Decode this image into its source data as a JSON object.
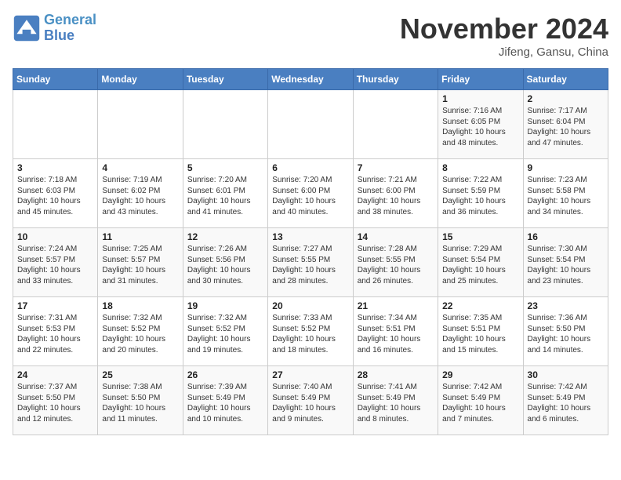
{
  "header": {
    "logo_line1": "General",
    "logo_line2": "Blue",
    "month": "November 2024",
    "location": "Jifeng, Gansu, China"
  },
  "weekdays": [
    "Sunday",
    "Monday",
    "Tuesday",
    "Wednesday",
    "Thursday",
    "Friday",
    "Saturday"
  ],
  "weeks": [
    [
      {
        "day": "",
        "info": ""
      },
      {
        "day": "",
        "info": ""
      },
      {
        "day": "",
        "info": ""
      },
      {
        "day": "",
        "info": ""
      },
      {
        "day": "",
        "info": ""
      },
      {
        "day": "1",
        "info": "Sunrise: 7:16 AM\nSunset: 6:05 PM\nDaylight: 10 hours and 48 minutes."
      },
      {
        "day": "2",
        "info": "Sunrise: 7:17 AM\nSunset: 6:04 PM\nDaylight: 10 hours and 47 minutes."
      }
    ],
    [
      {
        "day": "3",
        "info": "Sunrise: 7:18 AM\nSunset: 6:03 PM\nDaylight: 10 hours and 45 minutes."
      },
      {
        "day": "4",
        "info": "Sunrise: 7:19 AM\nSunset: 6:02 PM\nDaylight: 10 hours and 43 minutes."
      },
      {
        "day": "5",
        "info": "Sunrise: 7:20 AM\nSunset: 6:01 PM\nDaylight: 10 hours and 41 minutes."
      },
      {
        "day": "6",
        "info": "Sunrise: 7:20 AM\nSunset: 6:00 PM\nDaylight: 10 hours and 40 minutes."
      },
      {
        "day": "7",
        "info": "Sunrise: 7:21 AM\nSunset: 6:00 PM\nDaylight: 10 hours and 38 minutes."
      },
      {
        "day": "8",
        "info": "Sunrise: 7:22 AM\nSunset: 5:59 PM\nDaylight: 10 hours and 36 minutes."
      },
      {
        "day": "9",
        "info": "Sunrise: 7:23 AM\nSunset: 5:58 PM\nDaylight: 10 hours and 34 minutes."
      }
    ],
    [
      {
        "day": "10",
        "info": "Sunrise: 7:24 AM\nSunset: 5:57 PM\nDaylight: 10 hours and 33 minutes."
      },
      {
        "day": "11",
        "info": "Sunrise: 7:25 AM\nSunset: 5:57 PM\nDaylight: 10 hours and 31 minutes."
      },
      {
        "day": "12",
        "info": "Sunrise: 7:26 AM\nSunset: 5:56 PM\nDaylight: 10 hours and 30 minutes."
      },
      {
        "day": "13",
        "info": "Sunrise: 7:27 AM\nSunset: 5:55 PM\nDaylight: 10 hours and 28 minutes."
      },
      {
        "day": "14",
        "info": "Sunrise: 7:28 AM\nSunset: 5:55 PM\nDaylight: 10 hours and 26 minutes."
      },
      {
        "day": "15",
        "info": "Sunrise: 7:29 AM\nSunset: 5:54 PM\nDaylight: 10 hours and 25 minutes."
      },
      {
        "day": "16",
        "info": "Sunrise: 7:30 AM\nSunset: 5:54 PM\nDaylight: 10 hours and 23 minutes."
      }
    ],
    [
      {
        "day": "17",
        "info": "Sunrise: 7:31 AM\nSunset: 5:53 PM\nDaylight: 10 hours and 22 minutes."
      },
      {
        "day": "18",
        "info": "Sunrise: 7:32 AM\nSunset: 5:52 PM\nDaylight: 10 hours and 20 minutes."
      },
      {
        "day": "19",
        "info": "Sunrise: 7:32 AM\nSunset: 5:52 PM\nDaylight: 10 hours and 19 minutes."
      },
      {
        "day": "20",
        "info": "Sunrise: 7:33 AM\nSunset: 5:52 PM\nDaylight: 10 hours and 18 minutes."
      },
      {
        "day": "21",
        "info": "Sunrise: 7:34 AM\nSunset: 5:51 PM\nDaylight: 10 hours and 16 minutes."
      },
      {
        "day": "22",
        "info": "Sunrise: 7:35 AM\nSunset: 5:51 PM\nDaylight: 10 hours and 15 minutes."
      },
      {
        "day": "23",
        "info": "Sunrise: 7:36 AM\nSunset: 5:50 PM\nDaylight: 10 hours and 14 minutes."
      }
    ],
    [
      {
        "day": "24",
        "info": "Sunrise: 7:37 AM\nSunset: 5:50 PM\nDaylight: 10 hours and 12 minutes."
      },
      {
        "day": "25",
        "info": "Sunrise: 7:38 AM\nSunset: 5:50 PM\nDaylight: 10 hours and 11 minutes."
      },
      {
        "day": "26",
        "info": "Sunrise: 7:39 AM\nSunset: 5:49 PM\nDaylight: 10 hours and 10 minutes."
      },
      {
        "day": "27",
        "info": "Sunrise: 7:40 AM\nSunset: 5:49 PM\nDaylight: 10 hours and 9 minutes."
      },
      {
        "day": "28",
        "info": "Sunrise: 7:41 AM\nSunset: 5:49 PM\nDaylight: 10 hours and 8 minutes."
      },
      {
        "day": "29",
        "info": "Sunrise: 7:42 AM\nSunset: 5:49 PM\nDaylight: 10 hours and 7 minutes."
      },
      {
        "day": "30",
        "info": "Sunrise: 7:42 AM\nSunset: 5:49 PM\nDaylight: 10 hours and 6 minutes."
      }
    ]
  ]
}
